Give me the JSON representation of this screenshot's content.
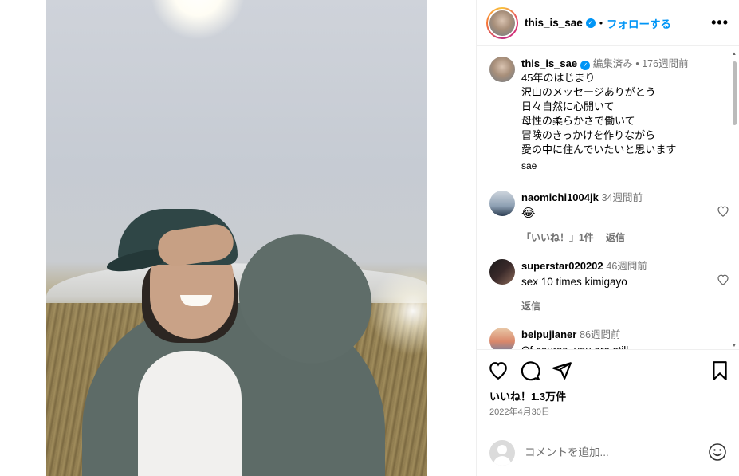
{
  "post": {
    "username": "this_is_sae",
    "follow_label": "フォローする",
    "edited_label": "編集済み",
    "caption_time": "176週間前",
    "caption_lines": [
      "45年のはじまり",
      "沢山のメッセージありがとう",
      "日々自然に心開いて",
      "母性の柔らかさで働いて",
      "冒険のきっかけを作りながら",
      "愛の中に住んでいたいと思います"
    ],
    "signature": "sae",
    "likes_label": "いいね！1.3万件",
    "date": "2022年4月30日"
  },
  "comments": [
    {
      "username": "naomichi1004jk",
      "time": "34週間前",
      "text": "😂",
      "likes": "「いいね！」1件",
      "reply": "返信"
    },
    {
      "username": "superstar020202",
      "time": "46週間前",
      "text": "sex 10 times kimigayo",
      "likes": "",
      "reply": "返信"
    },
    {
      "username": "beipujianer",
      "time": "86週間前",
      "text": "Of course, you are still",
      "likes": "",
      "reply": ""
    }
  ],
  "comment_box": {
    "placeholder": "コメントを追加..."
  },
  "icons": [
    "more-icon",
    "verified-icon",
    "heart-icon",
    "comment-icon",
    "share-icon",
    "bookmark-icon",
    "emoji-icon"
  ],
  "colors": {
    "accent": "#0095f6",
    "muted": "#737373",
    "border": "#efefef"
  }
}
